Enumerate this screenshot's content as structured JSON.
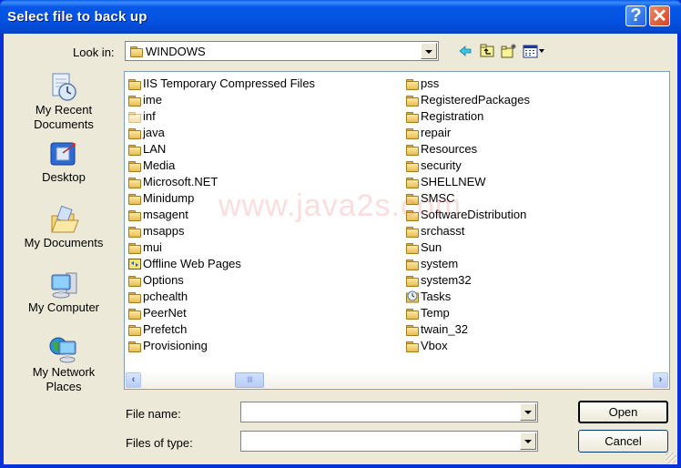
{
  "window": {
    "title": "Select file to back up",
    "help_label": "?",
    "close_label": "✕"
  },
  "lookin": {
    "label": "Look in:",
    "value": "WINDOWS",
    "icon": "folder-icon"
  },
  "toolbar": {
    "items": [
      "back-icon",
      "up-one-level-icon",
      "new-folder-icon",
      "view-menu-icon"
    ]
  },
  "places": [
    {
      "label": "My Recent Documents",
      "icon": "recent-documents-icon"
    },
    {
      "label": "Desktop",
      "icon": "desktop-icon"
    },
    {
      "label": "My Documents",
      "icon": "my-documents-icon"
    },
    {
      "label": "My Computer",
      "icon": "my-computer-icon"
    },
    {
      "label": "My Network Places",
      "icon": "network-places-icon"
    }
  ],
  "files": {
    "column1": [
      {
        "name": "IIS Temporary Compressed Files",
        "icon": "folder-icon"
      },
      {
        "name": "ime",
        "icon": "folder-icon"
      },
      {
        "name": "inf",
        "icon": "hidden-folder-icon"
      },
      {
        "name": "java",
        "icon": "folder-icon"
      },
      {
        "name": "LAN",
        "icon": "folder-icon"
      },
      {
        "name": "Media",
        "icon": "folder-icon"
      },
      {
        "name": "Microsoft.NET",
        "icon": "folder-icon"
      },
      {
        "name": "Minidump",
        "icon": "folder-icon"
      },
      {
        "name": "msagent",
        "icon": "folder-icon"
      },
      {
        "name": "msapps",
        "icon": "folder-icon"
      },
      {
        "name": "mui",
        "icon": "folder-icon"
      },
      {
        "name": "Offline Web Pages",
        "icon": "offline-pages-icon"
      },
      {
        "name": "Options",
        "icon": "folder-icon"
      },
      {
        "name": "pchealth",
        "icon": "folder-icon"
      },
      {
        "name": "PeerNet",
        "icon": "folder-icon"
      },
      {
        "name": "Prefetch",
        "icon": "folder-icon"
      },
      {
        "name": "Provisioning",
        "icon": "folder-icon"
      }
    ],
    "column2": [
      {
        "name": "pss",
        "icon": "folder-icon"
      },
      {
        "name": "RegisteredPackages",
        "icon": "folder-icon"
      },
      {
        "name": "Registration",
        "icon": "folder-icon"
      },
      {
        "name": "repair",
        "icon": "folder-icon"
      },
      {
        "name": "Resources",
        "icon": "folder-icon"
      },
      {
        "name": "security",
        "icon": "folder-icon"
      },
      {
        "name": "SHELLNEW",
        "icon": "folder-icon"
      },
      {
        "name": "SMSC",
        "icon": "folder-icon"
      },
      {
        "name": "SoftwareDistribution",
        "icon": "folder-icon"
      },
      {
        "name": "srchasst",
        "icon": "folder-icon"
      },
      {
        "name": "Sun",
        "icon": "folder-icon"
      },
      {
        "name": "system",
        "icon": "folder-icon"
      },
      {
        "name": "system32",
        "icon": "folder-icon"
      },
      {
        "name": "Tasks",
        "icon": "scheduled-tasks-icon"
      },
      {
        "name": "Temp",
        "icon": "folder-icon"
      },
      {
        "name": "twain_32",
        "icon": "folder-icon"
      },
      {
        "name": "Vbox",
        "icon": "folder-icon"
      }
    ]
  },
  "watermark": "www.java2s.com",
  "scrollbar": {
    "left_arrow": "‹",
    "right_arrow": "›",
    "grip": "IIII"
  },
  "form": {
    "filename_label": "File name:",
    "filename_value": "",
    "filetype_label": "Files of type:",
    "filetype_value": ""
  },
  "buttons": {
    "open": "Open",
    "cancel": "Cancel"
  }
}
